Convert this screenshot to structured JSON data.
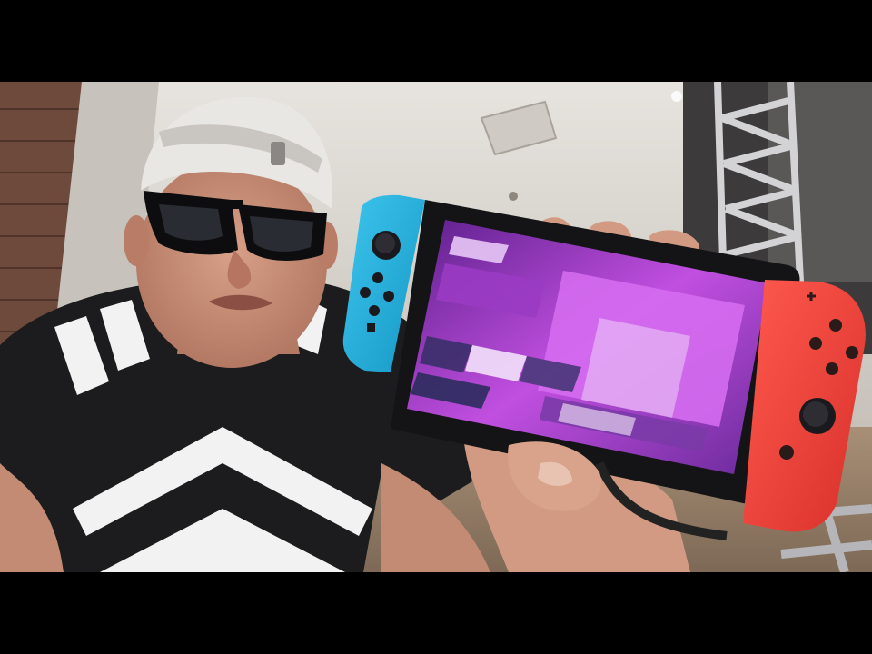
{
  "scene": {
    "subject": "man-with-backwards-cap-and-sunglasses",
    "device": "handheld-game-console",
    "colors": {
      "background": "#000000",
      "ceiling": "#d9d6d1",
      "brick": "#6e4a3c",
      "shirt": "#1c1c1e",
      "stripe": "#f2f2f2",
      "skin": "#c8907a",
      "cap": "#e9e7e4",
      "left_controller": "#1fb4e0",
      "right_controller": "#f2443a",
      "screen_glow": "#b04ad6",
      "truss": "#c9c9cc"
    }
  }
}
